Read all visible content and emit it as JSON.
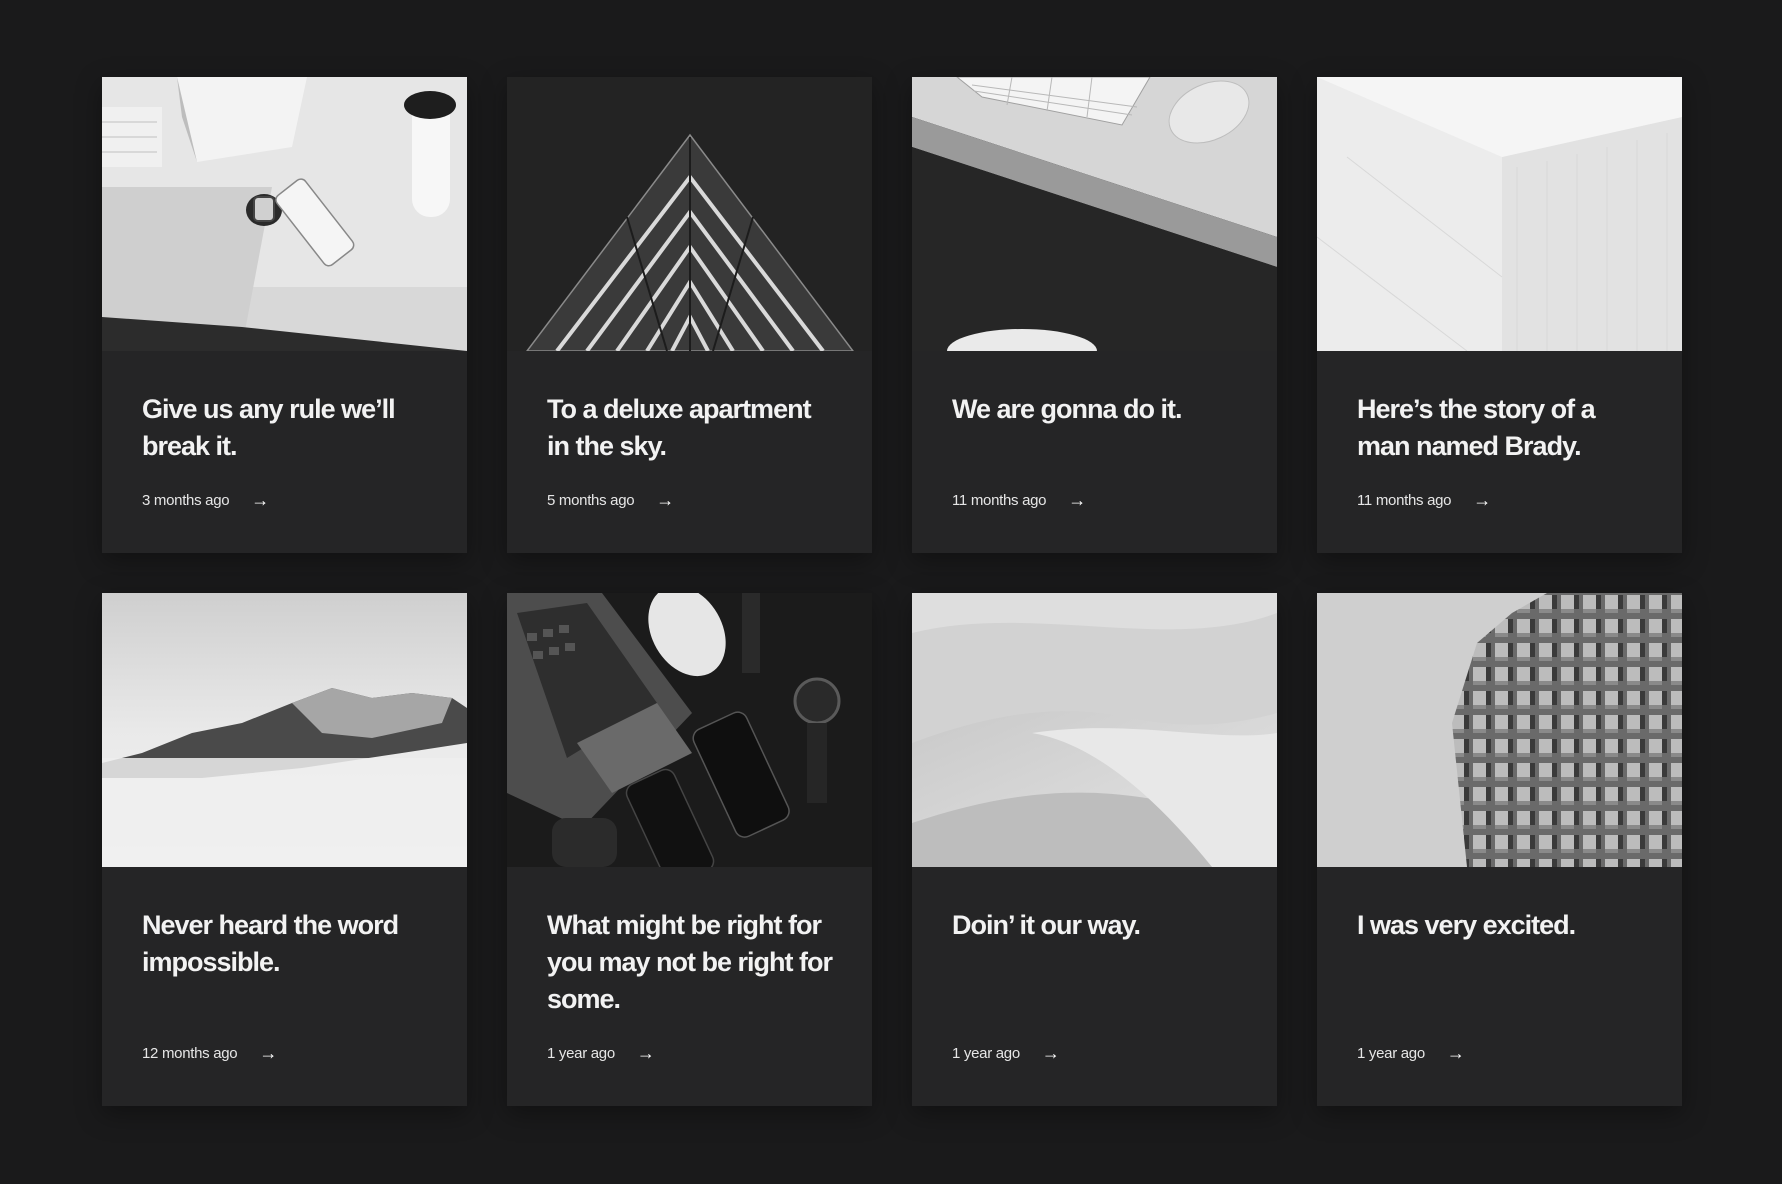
{
  "posts": [
    {
      "title": "Give us any rule we’ll break it.",
      "date": "3 months ago",
      "arrow": "→"
    },
    {
      "title": "To a deluxe apartment in the sky.",
      "date": "5 months ago",
      "arrow": "→"
    },
    {
      "title": "We are gonna do it.",
      "date": "11 months ago",
      "arrow": "→"
    },
    {
      "title": "Here’s the story of a man named Brady.",
      "date": "11 months ago",
      "arrow": "→"
    },
    {
      "title": "Never heard the word impossible.",
      "date": "12 months ago",
      "arrow": "→"
    },
    {
      "title": "What might be right for you may not be right for some.",
      "date": "1 year ago",
      "arrow": "→"
    },
    {
      "title": "Doin’ it our way.",
      "date": "1 year ago",
      "arrow": "→"
    },
    {
      "title": "I was very excited.",
      "date": "1 year ago",
      "arrow": "→"
    }
  ],
  "colors": {
    "page_bg": "#1a1a1b",
    "card_bg": "#252526",
    "text": "#ffffff"
  }
}
